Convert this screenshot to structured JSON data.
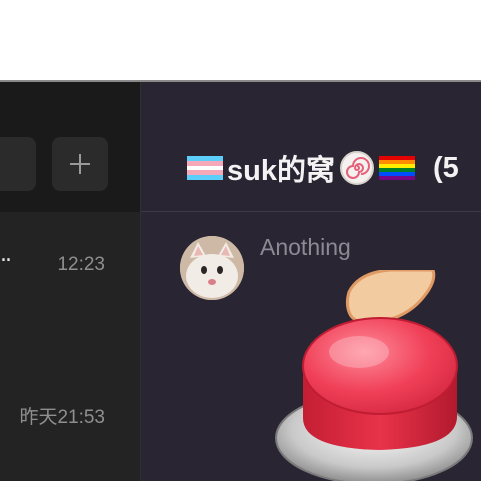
{
  "chat_list": {
    "items": [
      {
        "preview": "..",
        "time": "12:23"
      },
      {
        "preview": "",
        "time": "昨天21:53"
      }
    ]
  },
  "chat": {
    "title": "suk的窝",
    "member_count": "(5",
    "messages": [
      {
        "sender": "Anothing",
        "type": "sticker",
        "sticker": "red-button-sticker"
      }
    ]
  },
  "icons": {
    "add": "plus-icon",
    "flags": [
      "transgender-flag-emoji",
      "fish-cake-emoji",
      "rainbow-flag-emoji"
    ]
  },
  "colors": {
    "sidebar_bg": "#1f1f1f",
    "chat_bg": "#2a2532",
    "time_text": "#8f8f8f",
    "sender_text": "#8d8a94",
    "button_red": "#e8334a"
  }
}
